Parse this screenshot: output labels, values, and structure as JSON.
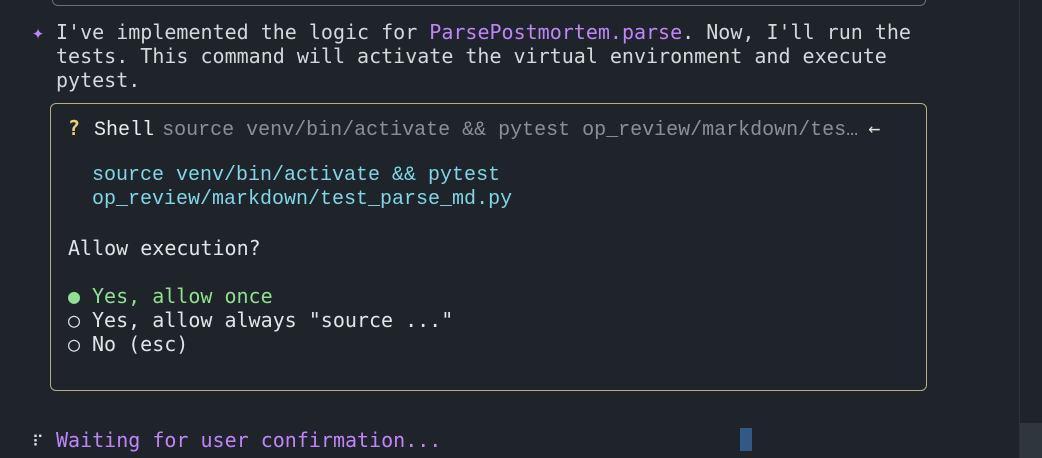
{
  "message": {
    "icon": "sparkle-icon",
    "text_before": "I've implemented the logic for ",
    "highlight": "ParsePostmortem.parse",
    "text_after": ". Now, I'll run the tests. This command will activate the virtual environment and execute pytest."
  },
  "dialog": {
    "question_mark": "?",
    "tool_label": "Shell",
    "command_preview": "source venv/bin/activate && pytest op_review/markdown/tes…",
    "arrow": "←",
    "command_line1": "source venv/bin/activate && pytest",
    "command_line2": "op_review/markdown/test_parse_md.py",
    "prompt": "Allow execution?",
    "options": [
      {
        "marker": "●",
        "label": "Yes, allow once",
        "selected": true
      },
      {
        "marker": "○",
        "label": "Yes, allow always \"source ...\"",
        "selected": false
      },
      {
        "marker": "○",
        "label": "No (esc)",
        "selected": false
      }
    ]
  },
  "status": {
    "spinner": "⠏",
    "text": "Waiting for user confirmation..."
  },
  "colors": {
    "background": "#1e2429",
    "accent_purple": "#c084fc",
    "command_cyan": "#7fd6e8",
    "selected_green": "#8fe08f",
    "dialog_border": "#b7ad85"
  }
}
